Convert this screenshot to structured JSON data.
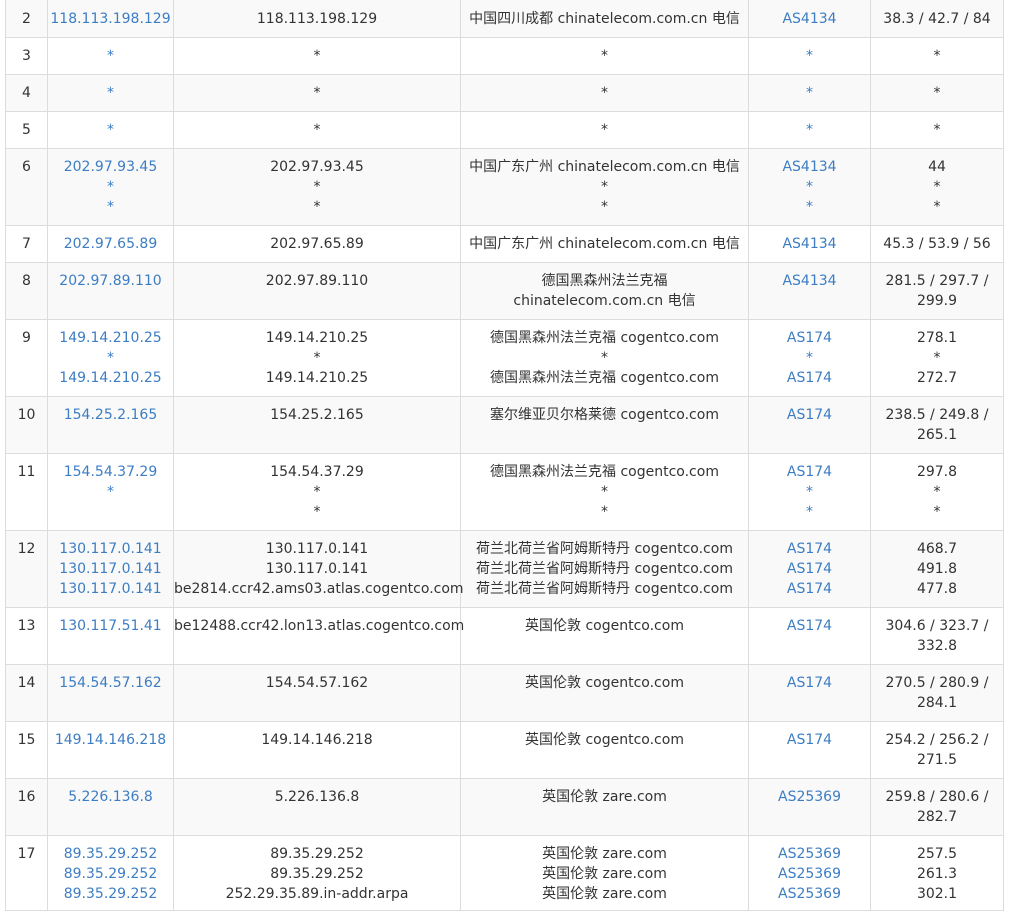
{
  "rows": [
    {
      "hop": "2",
      "ip": [
        "118.113.198.129"
      ],
      "host": [
        "118.113.198.129"
      ],
      "loc": [
        "中国四川成都 chinatelecom.com.cn 电信"
      ],
      "asn": [
        "AS4134"
      ],
      "rtt": [
        "38.3 / 42.7 / 84"
      ]
    },
    {
      "hop": "3",
      "ip": [
        "*"
      ],
      "host": [
        "*"
      ],
      "loc": [
        "*"
      ],
      "asn": [
        "*"
      ],
      "rtt": [
        "*"
      ]
    },
    {
      "hop": "4",
      "ip": [
        "*"
      ],
      "host": [
        "*"
      ],
      "loc": [
        "*"
      ],
      "asn": [
        "*"
      ],
      "rtt": [
        "*"
      ]
    },
    {
      "hop": "5",
      "ip": [
        "*"
      ],
      "host": [
        "*"
      ],
      "loc": [
        "*"
      ],
      "asn": [
        "*"
      ],
      "rtt": [
        "*"
      ]
    },
    {
      "hop": "6",
      "ip": [
        "202.97.93.45",
        "*",
        "*"
      ],
      "host": [
        "202.97.93.45",
        "*",
        "*"
      ],
      "loc": [
        "中国广东广州 chinatelecom.com.cn 电信",
        "*",
        "*"
      ],
      "asn": [
        "AS4134",
        "*",
        "*"
      ],
      "rtt": [
        "44",
        "*",
        "*"
      ]
    },
    {
      "hop": "7",
      "ip": [
        "202.97.65.89"
      ],
      "host": [
        "202.97.65.89"
      ],
      "loc": [
        "中国广东广州 chinatelecom.com.cn 电信"
      ],
      "asn": [
        "AS4134"
      ],
      "rtt": [
        "45.3 / 53.9 / 56"
      ]
    },
    {
      "hop": "8",
      "ip": [
        "202.97.89.110"
      ],
      "host": [
        "202.97.89.110"
      ],
      "loc": [
        "德国黑森州法兰克福",
        "chinatelecom.com.cn 电信"
      ],
      "asn": [
        "AS4134"
      ],
      "rtt": [
        "281.5 / 297.7 /",
        "299.9"
      ]
    },
    {
      "hop": "9",
      "ip": [
        "149.14.210.25",
        "*",
        "149.14.210.25"
      ],
      "host": [
        "149.14.210.25",
        "*",
        "149.14.210.25"
      ],
      "loc": [
        "德国黑森州法兰克福 cogentco.com",
        "*",
        "德国黑森州法兰克福 cogentco.com"
      ],
      "asn": [
        "AS174",
        "*",
        "AS174"
      ],
      "rtt": [
        "278.1",
        "*",
        "272.7"
      ]
    },
    {
      "hop": "10",
      "ip": [
        "154.25.2.165"
      ],
      "host": [
        "154.25.2.165"
      ],
      "loc": [
        "塞尔维亚贝尔格莱德 cogentco.com"
      ],
      "asn": [
        "AS174"
      ],
      "rtt": [
        "238.5 / 249.8 /",
        "265.1"
      ]
    },
    {
      "hop": "11",
      "ip": [
        "154.54.37.29",
        "*"
      ],
      "host": [
        "154.54.37.29",
        "*",
        "*"
      ],
      "loc": [
        "德国黑森州法兰克福 cogentco.com",
        "*",
        "*"
      ],
      "asn": [
        "AS174",
        "*",
        "*"
      ],
      "rtt": [
        "297.8",
        "*",
        "*"
      ]
    },
    {
      "hop": "12",
      "ip": [
        "130.117.0.141",
        "130.117.0.141",
        "130.117.0.141"
      ],
      "host": [
        "130.117.0.141",
        "130.117.0.141",
        "be2814.ccr42.ams03.atlas.cogentco.com"
      ],
      "loc": [
        "荷兰北荷兰省阿姆斯特丹 cogentco.com",
        "荷兰北荷兰省阿姆斯特丹 cogentco.com",
        "荷兰北荷兰省阿姆斯特丹 cogentco.com"
      ],
      "asn": [
        "AS174",
        "AS174",
        "AS174"
      ],
      "rtt": [
        "468.7",
        "491.8",
        "477.8"
      ]
    },
    {
      "hop": "13",
      "ip": [
        "130.117.51.41"
      ],
      "host": [
        "be12488.ccr42.lon13.atlas.cogentco.com"
      ],
      "loc": [
        "英国伦敦 cogentco.com"
      ],
      "asn": [
        "AS174"
      ],
      "rtt": [
        "304.6 / 323.7 /",
        "332.8"
      ]
    },
    {
      "hop": "14",
      "ip": [
        "154.54.57.162"
      ],
      "host": [
        "154.54.57.162"
      ],
      "loc": [
        "英国伦敦 cogentco.com"
      ],
      "asn": [
        "AS174"
      ],
      "rtt": [
        "270.5 / 280.9 /",
        "284.1"
      ]
    },
    {
      "hop": "15",
      "ip": [
        "149.14.146.218"
      ],
      "host": [
        "149.14.146.218"
      ],
      "loc": [
        "英国伦敦 cogentco.com"
      ],
      "asn": [
        "AS174"
      ],
      "rtt": [
        "254.2 / 256.2 /",
        "271.5"
      ]
    },
    {
      "hop": "16",
      "ip": [
        "5.226.136.8"
      ],
      "host": [
        "5.226.136.8"
      ],
      "loc": [
        "英国伦敦 zare.com"
      ],
      "asn": [
        "AS25369"
      ],
      "rtt": [
        "259.8 / 280.6 /",
        "282.7"
      ]
    },
    {
      "hop": "17",
      "ip": [
        "89.35.29.252",
        "89.35.29.252",
        "89.35.29.252"
      ],
      "host": [
        "89.35.29.252",
        "89.35.29.252",
        "252.29.35.89.in-addr.arpa"
      ],
      "loc": [
        "英国伦敦 zare.com",
        "英国伦敦 zare.com",
        "英国伦敦 zare.com"
      ],
      "asn": [
        "AS25369",
        "AS25369",
        "AS25369"
      ],
      "rtt": [
        "257.5",
        "261.3",
        "302.1"
      ]
    }
  ],
  "colors": {
    "link": "#3c7dc4",
    "text": "#333333",
    "border": "#dcdcdc",
    "stripe": "#f9f9f9"
  }
}
